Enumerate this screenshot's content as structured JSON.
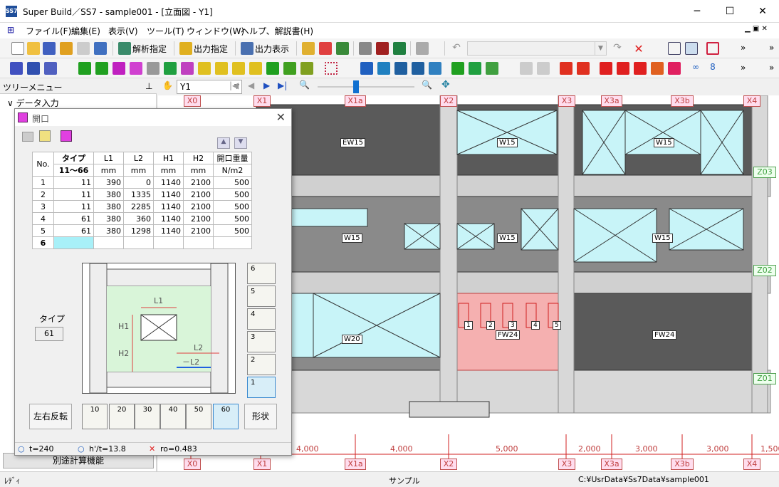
{
  "window": {
    "title": "Super Build／SS7 - sample001 - [立面図 - Y1]"
  },
  "menu": [
    "ファイル(F)",
    "編集(E)",
    "表示(V)",
    "ツール(T)",
    "ウィンドウ(W)",
    "ヘルプ、解説書(H)"
  ],
  "toolbar": {
    "analysis": "解析指定",
    "output_spec": "出力指定",
    "output_view": "出力表示"
  },
  "tree": {
    "header": "ツリーメニュー",
    "root": "データ入力",
    "extra_button": "別途計算機能"
  },
  "view": {
    "frame": "Y1"
  },
  "dialog": {
    "title": "開口",
    "headers": {
      "no": "No.",
      "type": "タイプ",
      "type_range": "11～66",
      "l1": "L1",
      "l2": "L2",
      "h1": "H1",
      "h2": "H2",
      "weight": "開口重量",
      "unit_mm": "mm",
      "unit_weight": "N/m2"
    },
    "rows": [
      {
        "no": "1",
        "type": "11",
        "l1": "390",
        "l2": "0",
        "h1": "1140",
        "h2": "2100",
        "w": "500"
      },
      {
        "no": "2",
        "type": "11",
        "l1": "380",
        "l2": "1335",
        "h1": "1140",
        "h2": "2100",
        "w": "500"
      },
      {
        "no": "3",
        "type": "11",
        "l1": "380",
        "l2": "2285",
        "h1": "1140",
        "h2": "2100",
        "w": "500"
      },
      {
        "no": "4",
        "type": "61",
        "l1": "380",
        "l2": "360",
        "h1": "1140",
        "h2": "2100",
        "w": "500"
      },
      {
        "no": "5",
        "type": "61",
        "l1": "380",
        "l2": "1298",
        "h1": "1140",
        "h2": "2100",
        "w": "500"
      },
      {
        "no": "6",
        "type": "",
        "l1": "",
        "l2": "",
        "h1": "",
        "h2": "",
        "w": ""
      }
    ],
    "diagram_labels": {
      "l1": "L1",
      "l2": "L2",
      "neg_l2": "－L2",
      "h1": "H1",
      "h2": "H2"
    },
    "type_label": "タイプ",
    "type_value": "61",
    "vpos_buttons": [
      "6",
      "5",
      "4",
      "3",
      "2",
      "1"
    ],
    "hpos_buttons": [
      "10",
      "20",
      "30",
      "40",
      "50",
      "60"
    ],
    "flip_button": "左右反転",
    "shape_button": "形状",
    "status": {
      "t": "t=240",
      "ht": "h'/t=13.8",
      "ro": "ro=0.483"
    }
  },
  "grid_axes": {
    "x": [
      "X0",
      "X1",
      "X1a",
      "X2",
      "X3",
      "X3a",
      "X3b",
      "X4"
    ],
    "y": [
      "Z03",
      "Z02",
      "Z01"
    ],
    "spans": [
      "4,000",
      "4,000",
      "5,000",
      "2,000",
      "3,000",
      "3,000",
      "1,500"
    ]
  },
  "walls": [
    "EW15",
    "W15",
    "W15",
    "W15",
    "W15",
    "W15",
    "W20",
    "FW24",
    "FW24"
  ],
  "openings": [
    "1",
    "2",
    "3",
    "4",
    "5"
  ],
  "statusbar": {
    "left": "ﾚﾃﾞｨ",
    "center": "サンプル",
    "path": "C:¥UsrData¥Ss7Data¥sample001"
  }
}
